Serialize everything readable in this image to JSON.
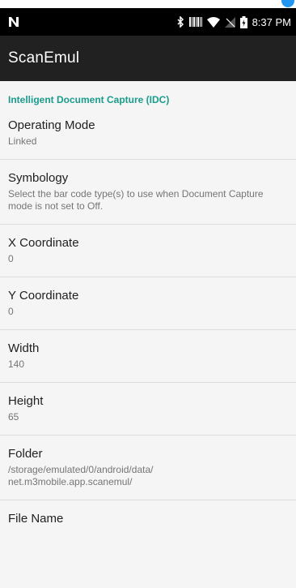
{
  "status_bar": {
    "notification_icon": "n-icon",
    "time": "8:37 PM",
    "icons": [
      "bluetooth-icon",
      "barcode-icon",
      "wifi-icon",
      "no-signal-icon",
      "battery-icon"
    ]
  },
  "app_bar": {
    "title": "ScanEmul"
  },
  "section": {
    "title": "Intelligent Document Capture (IDC)"
  },
  "preferences": [
    {
      "title": "Operating Mode",
      "summary": "Linked"
    },
    {
      "title": "Symbology",
      "summary": "Select the bar code type(s) to use when Document Capture mode is not set to Off."
    },
    {
      "title": "X Coordinate",
      "summary": "0"
    },
    {
      "title": "Y Coordinate",
      "summary": "0"
    },
    {
      "title": "Width",
      "summary": "140"
    },
    {
      "title": "Height",
      "summary": "65"
    },
    {
      "title": "Folder",
      "summary": "/storage/emulated/0/android/data/\nnet.m3mobile.app.scanemul/"
    },
    {
      "title": "File Name",
      "summary": ""
    }
  ],
  "colors": {
    "status_bar": "#000000",
    "app_bar": "#212121",
    "section_header": "#1a9b8c",
    "background": "#f5f5f5",
    "accent_dot": "#2196F3"
  }
}
